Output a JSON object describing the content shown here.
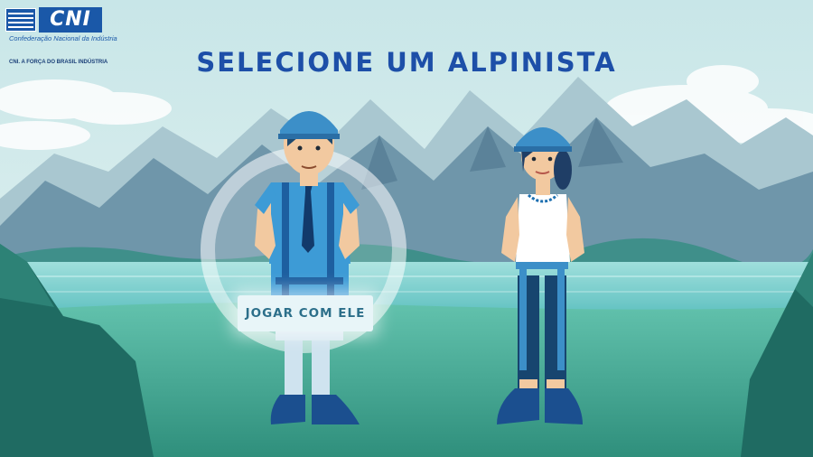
{
  "header": {
    "logo_main": "CNI",
    "logo_subtitle": "Confederação Nacional da Indústria",
    "logo_tagline": "CNI. A FORÇA DO BRASIL INDÚSTRIA"
  },
  "title": "SELECIONE UM ALPINISTA",
  "selection": {
    "play_button_label": "JOGAR COM ELE"
  },
  "colors": {
    "title": "#1d4fa8",
    "brand": "#1a58a8",
    "helmet": "#3c8fc8",
    "grass": "#3fae9a",
    "water": "#7dd0d4"
  }
}
